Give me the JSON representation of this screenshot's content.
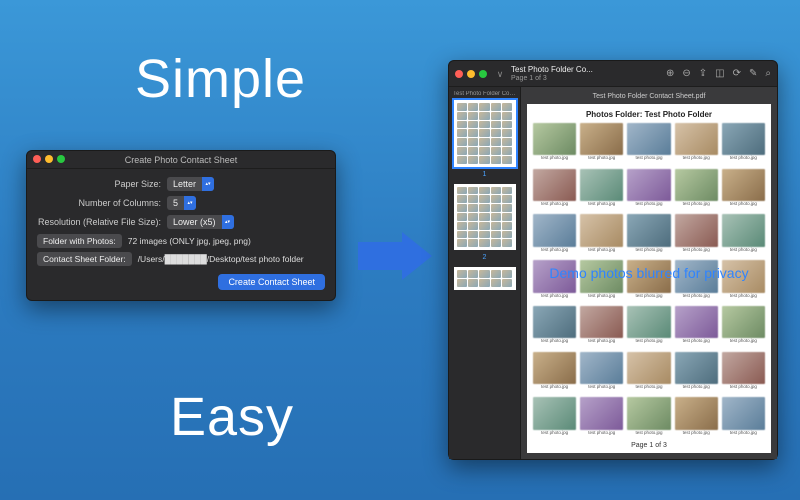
{
  "marketing": {
    "simple": "Simple",
    "easy": "Easy"
  },
  "settings_window": {
    "title": "Create Photo Contact Sheet",
    "paper_size": {
      "label": "Paper Size:",
      "value": "Letter"
    },
    "columns": {
      "label": "Number of Columns:",
      "value": "5"
    },
    "resolution": {
      "label": "Resolution (Relative File Size):",
      "value": "Lower (x5)"
    },
    "folder_photos": {
      "button": "Folder with Photos:",
      "value": "72 images (ONLY jpg, jpeg, png)"
    },
    "contact_folder": {
      "button": "Contact Sheet Folder:",
      "value": "/Users/███████/Desktop/test photo folder"
    },
    "create_button": "Create Contact Sheet"
  },
  "preview_window": {
    "doc_title": "Test Photo Folder Co...",
    "doc_subtitle": "Page 1 of 3",
    "toolbar_icons": [
      "zoom-in-icon",
      "zoom-out-icon",
      "share-icon",
      "highlight-icon",
      "rotate-icon",
      "markup-icon",
      "search-icon"
    ],
    "thumb_rail_title": "Test Photo Folder Contac...",
    "thumb_page_numbers": [
      "1",
      "2"
    ],
    "filename_header": "Test Photo Folder Contact Sheet.pdf",
    "sheet_title": "Photos Folder: Test Photo Folder",
    "privacy_overlay": "Demo photos blurred for privacy",
    "sheet_footer": "Page 1 of  3",
    "photo_caption_sample": "test photo.jpg"
  }
}
